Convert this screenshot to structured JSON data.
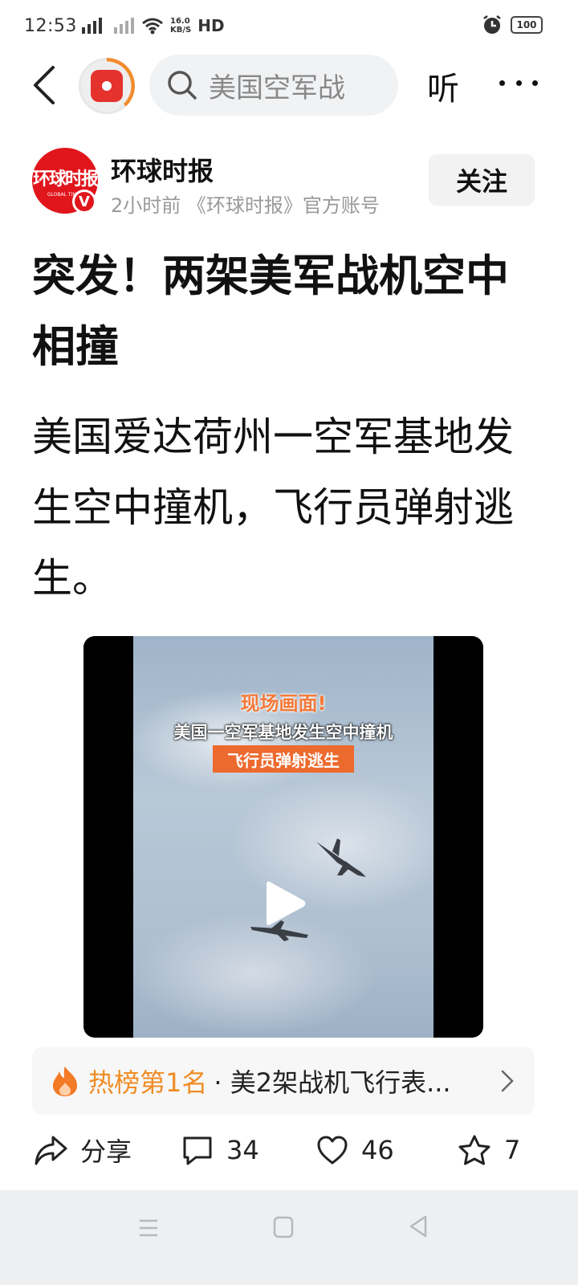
{
  "status_bar": {
    "time": "12:53",
    "network": "4G",
    "speed_value": "16.0",
    "speed_unit": "KB/S",
    "hd": "HD",
    "battery": "100"
  },
  "nav": {
    "search_placeholder": "美国空军战",
    "listen_label": "听"
  },
  "author": {
    "avatar_text": "环球时报",
    "avatar_sub": "GLOBAL TIMES",
    "verified_mark": "V",
    "name": "环球时报",
    "meta": "2小时前  《环球时报》官方账号",
    "follow_label": "关注"
  },
  "article": {
    "title": "突发！两架美军战机空中相撞",
    "body": "美国爱达荷州一空军基地发生空中撞机，飞行员弹射逃生。"
  },
  "video": {
    "caption_1": "现场画面!",
    "caption_2": "美国一空军基地发生空中撞机",
    "caption_3": "飞行员弹射逃生"
  },
  "hot_list": {
    "rank_label": "热榜第1名",
    "topic": "· 美2架战机飞行表..."
  },
  "actions": {
    "share_label": "分享",
    "comment_count": "34",
    "like_count": "46",
    "favorite_count": "7"
  },
  "colors": {
    "brand_red": "#e0161c",
    "hot_orange": "#f08c24"
  }
}
